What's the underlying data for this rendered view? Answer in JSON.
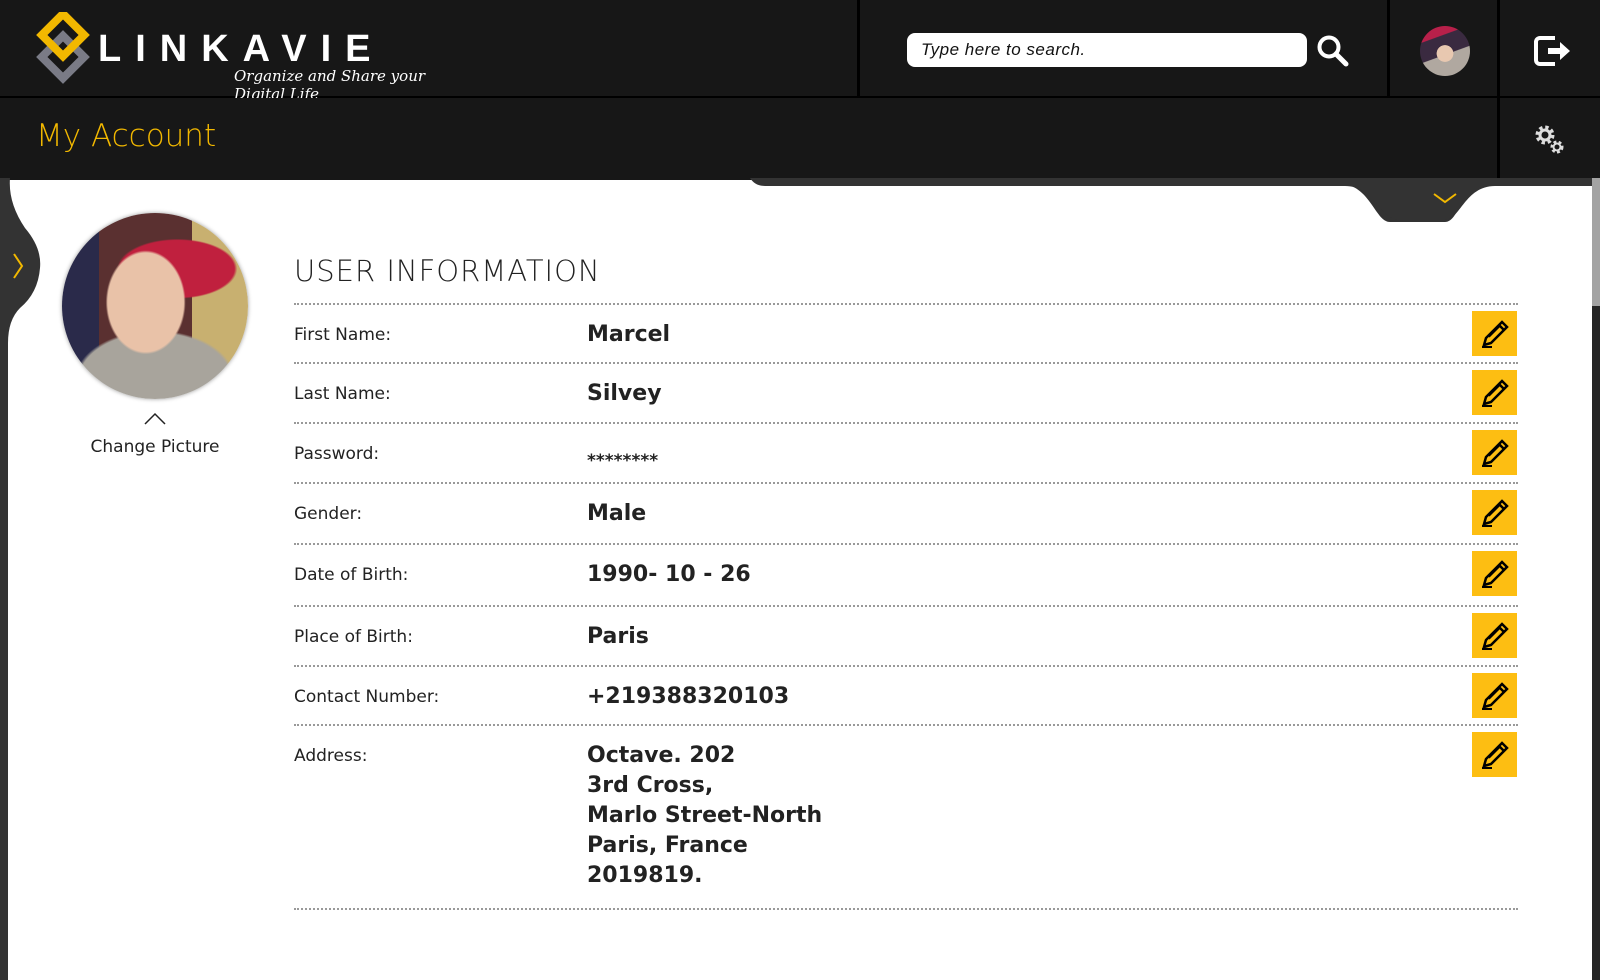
{
  "header": {
    "brand": "LINKAVIE",
    "tagline": "Organize and Share your Digital Life",
    "search_placeholder": "Type here to search."
  },
  "page": {
    "title": "My Account"
  },
  "profile": {
    "change_picture": "Change Picture"
  },
  "section": {
    "heading": "USER INFORMATION"
  },
  "fields": [
    {
      "label": "First Name:",
      "value": "Marcel"
    },
    {
      "label": "Last Name:",
      "value": "Silvey"
    },
    {
      "label": "Password:",
      "value": "********"
    },
    {
      "label": "Gender:",
      "value": "Male"
    },
    {
      "label": "Date of Birth:",
      "value": "1990- 10 - 26"
    },
    {
      "label": "Place of Birth:",
      "value": "Paris"
    },
    {
      "label": "Contact Number:",
      "value": "+219388320103"
    },
    {
      "label": "Address:",
      "value": "Octave. 202\n3rd Cross,\nMarlo Street-North\nParis, France\n2019819."
    }
  ],
  "colors": {
    "accent": "#f2b800",
    "edit_bg": "#fdbe12",
    "bar": "#171717"
  }
}
